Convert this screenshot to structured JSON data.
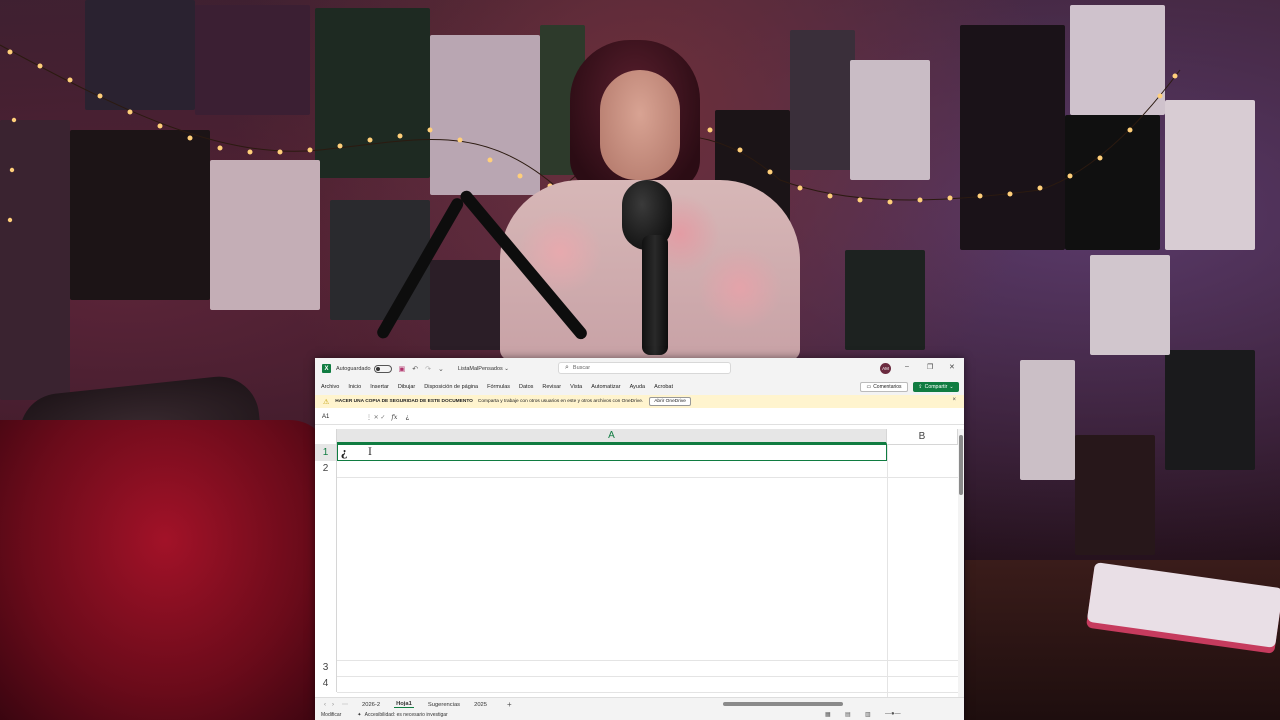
{
  "excel": {
    "titlebar": {
      "app_logo": "X",
      "autosave_label": "Autoguardado",
      "filename": "ListaMalPensados ⌄",
      "search_placeholder": "Buscar",
      "user_initials": "AM"
    },
    "menu": [
      "Archivo",
      "Inicio",
      "Insertar",
      "Dibujar",
      "Disposición de página",
      "Fórmulas",
      "Datos",
      "Revisar",
      "Vista",
      "Automatizar",
      "Ayuda",
      "Acrobat"
    ],
    "comments_label": "Comentarios",
    "share_label": "Compartir",
    "infobar": {
      "title": "HACER UNA COPIA DE SEGURIDAD DE ESTE DOCUMENTO",
      "message": "Comparta y trabaje con otros usuarios en este y otros archivos con OneDrive.",
      "button": "Abrir OneDrive",
      "close": "×"
    },
    "formula_bar": {
      "name_box": "A1",
      "fx": "fx",
      "value": "¿"
    },
    "columns": [
      "A",
      "B"
    ],
    "rows": [
      "1",
      "2",
      "3",
      "4"
    ],
    "active_cell_text": "¿",
    "sheets": [
      "2026-2",
      "Hoja1",
      "Sugerencias",
      "2025"
    ],
    "active_sheet": "Hoja1",
    "status": {
      "mode": "Modificar",
      "accessibility": "Accesibilidad: es necesario investigar"
    }
  },
  "colors": {
    "excel_green": "#107c41",
    "info_bar": "#fff4ce"
  }
}
